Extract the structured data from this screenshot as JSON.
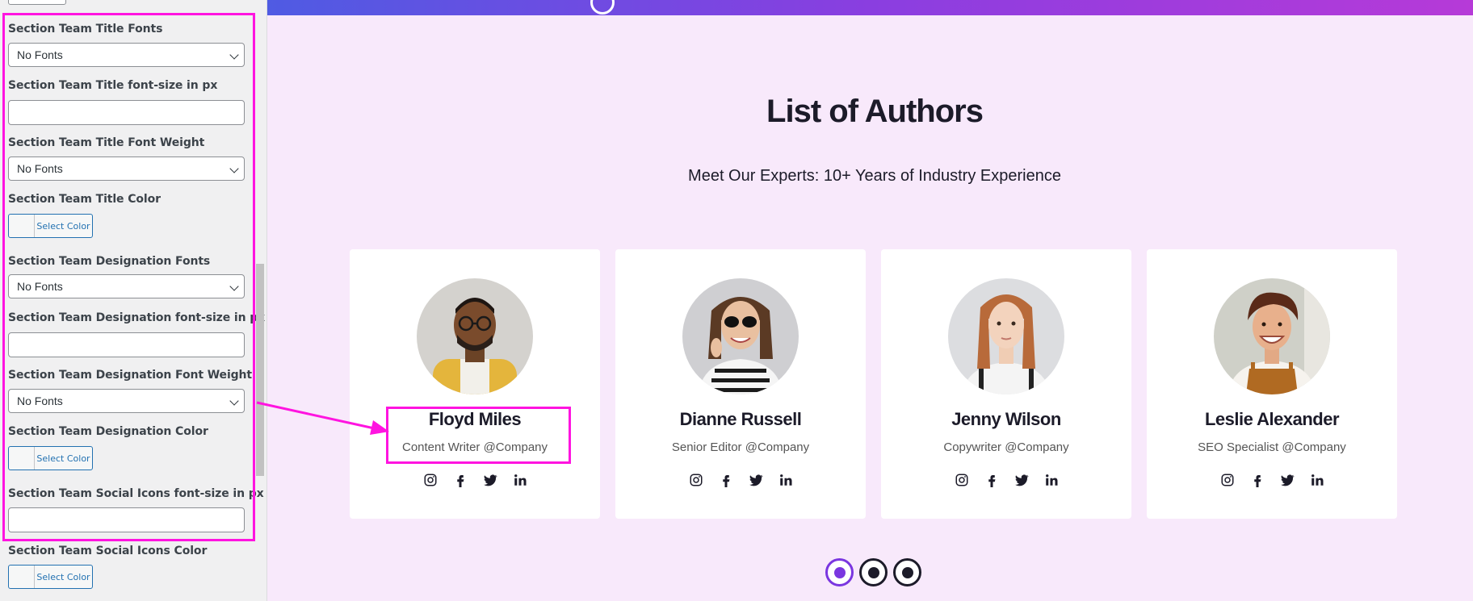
{
  "settings_panel": {
    "fields": [
      {
        "label": "Section Team Title Fonts",
        "type": "select",
        "value": "No Fonts"
      },
      {
        "label": "Section Team Title font-size in px",
        "type": "text",
        "value": ""
      },
      {
        "label": "Section Team Title Font Weight",
        "type": "select",
        "value": "No Fonts"
      },
      {
        "label": "Section Team Title Color",
        "type": "color",
        "button": "Select Color"
      },
      {
        "label": "Section Team Designation Fonts",
        "type": "select",
        "value": "No Fonts"
      },
      {
        "label": "Section Team Designation font-size in px",
        "type": "text",
        "value": ""
      },
      {
        "label": "Section Team Designation Font Weight",
        "type": "select",
        "value": "No Fonts"
      },
      {
        "label": "Section Team Designation Color",
        "type": "color",
        "button": "Select Color"
      },
      {
        "label": "Section Team Social Icons font-size in px",
        "type": "text",
        "value": ""
      },
      {
        "label": "Section Team Social Icons Color",
        "type": "color",
        "button": "Select Color"
      }
    ]
  },
  "section": {
    "title": "List of Authors",
    "subtitle": "Meet Our Experts: 10+ Years of Industry Experience"
  },
  "team": [
    {
      "name": "Floyd Miles",
      "role": "Content Writer @Company"
    },
    {
      "name": "Dianne Russell",
      "role": "Senior Editor @Company"
    },
    {
      "name": "Jenny Wilson",
      "role": "Copywriter @Company"
    },
    {
      "name": "Leslie Alexander",
      "role": "SEO Specialist @Company"
    }
  ],
  "social_icons": [
    "instagram-icon",
    "facebook-icon",
    "twitter-icon",
    "linkedin-icon"
  ],
  "pagination": {
    "pages": 3,
    "active": 1
  },
  "colors": {
    "highlight": "#ff14e0",
    "accent": "#7a36e0",
    "page_bg": "#f8e9fb"
  }
}
